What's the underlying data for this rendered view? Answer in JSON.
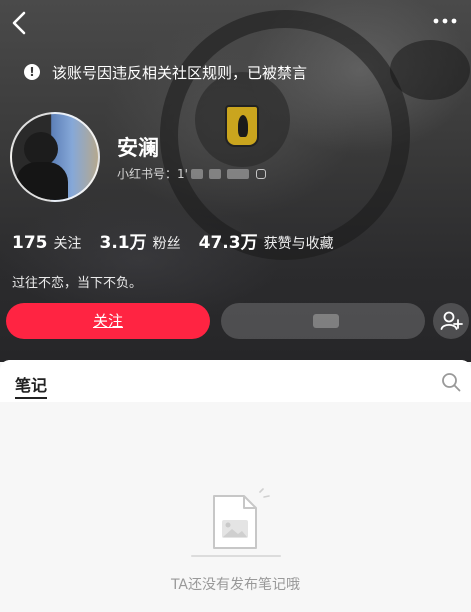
{
  "notice": {
    "text": "该账号因违反相关社区规则，已被禁言",
    "icon": "exclamation-circle-icon"
  },
  "profile": {
    "name": "安澜",
    "id_label": "小红书号：",
    "id_visible": "1'",
    "bio": "过往不恋，当下不负。"
  },
  "stats": [
    {
      "value": "175",
      "label": "关注"
    },
    {
      "value": "3.1万",
      "label": "粉丝"
    },
    {
      "value": "47.3万",
      "label": "获赞与收藏"
    }
  ],
  "actions": {
    "follow_label": "关注",
    "follow_color": "#ff2442"
  },
  "tabs": {
    "notes": "笔记"
  },
  "empty": {
    "text": "TA还没有发布笔记哦"
  },
  "icons": {
    "back": "back-arrow-icon",
    "more": "more-dots-icon",
    "add_friend": "add-friend-icon",
    "search": "search-icon",
    "copy": "copy-icon",
    "empty_note": "empty-document-icon"
  }
}
